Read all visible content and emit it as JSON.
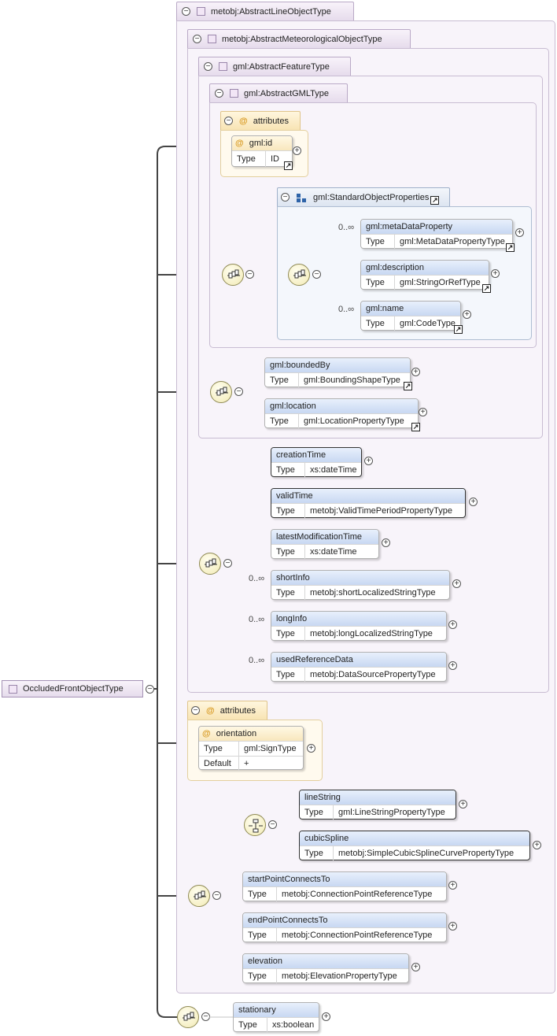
{
  "root": {
    "name": "OccludedFrontObjectType"
  },
  "types": {
    "line_object": "metobj:AbstractLineObjectType",
    "meteorological_object": "metobj:AbstractMeteorologicalObjectType",
    "feature": "gml:AbstractFeatureType",
    "gml": "gml:AbstractGMLType"
  },
  "attributes_label": "attributes",
  "type_key": "Type",
  "default_key": "Default",
  "gml_id": {
    "name": "gml:id",
    "type": "ID"
  },
  "group": {
    "name": "gml:StandardObjectProperties"
  },
  "cardinality_many": "0..∞",
  "elements": {
    "metaDataProperty": {
      "name": "gml:metaDataProperty",
      "type": "gml:MetaDataPropertyType"
    },
    "description": {
      "name": "gml:description",
      "type": "gml:StringOrRefType"
    },
    "gml_name": {
      "name": "gml:name",
      "type": "gml:CodeType"
    },
    "boundedBy": {
      "name": "gml:boundedBy",
      "type": "gml:BoundingShapeType"
    },
    "location": {
      "name": "gml:location",
      "type": "gml:LocationPropertyType"
    },
    "creationTime": {
      "name": "creationTime",
      "type": "xs:dateTime"
    },
    "validTime": {
      "name": "validTime",
      "type": "metobj:ValidTimePeriodPropertyType"
    },
    "latestModificationTime": {
      "name": "latestModificationTime",
      "type": "xs:dateTime"
    },
    "shortInfo": {
      "name": "shortInfo",
      "type": "metobj:shortLocalizedStringType"
    },
    "longInfo": {
      "name": "longInfo",
      "type": "metobj:longLocalizedStringType"
    },
    "usedReferenceData": {
      "name": "usedReferenceData",
      "type": "metobj:DataSourcePropertyType"
    },
    "lineString": {
      "name": "lineString",
      "type": "gml:LineStringPropertyType"
    },
    "cubicSpline": {
      "name": "cubicSpline",
      "type": "metobj:SimpleCubicSplineCurvePropertyType"
    },
    "startPointConnectsTo": {
      "name": "startPointConnectsTo",
      "type": "metobj:ConnectionPointReferenceType"
    },
    "endPointConnectsTo": {
      "name": "endPointConnectsTo",
      "type": "metobj:ConnectionPointReferenceType"
    },
    "elevation": {
      "name": "elevation",
      "type": "metobj:ElevationPropertyType"
    },
    "stationary": {
      "name": "stationary",
      "type": "xs:boolean"
    }
  },
  "orientation": {
    "name": "orientation",
    "type": "gml:SignType",
    "default": "+"
  }
}
